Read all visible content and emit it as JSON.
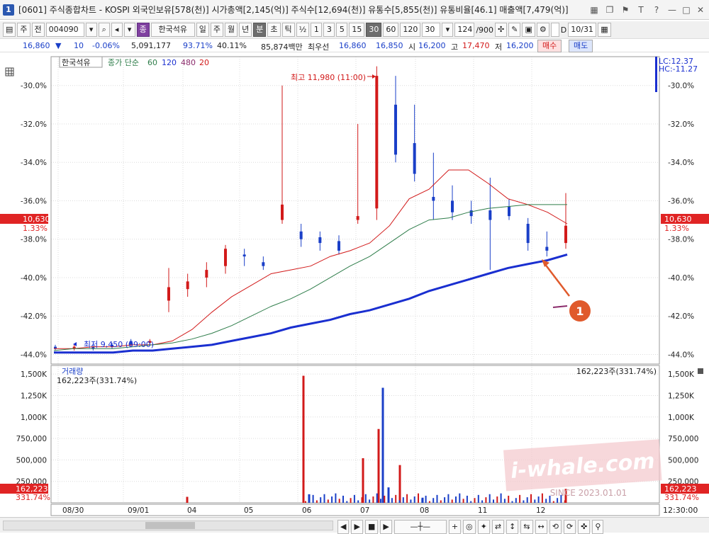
{
  "window": {
    "badge": "1",
    "title": "[0601] 주식종합차트 - KOSPI 외국인보유[578(천)] 시가총액[2,145(억)] 주식수[12,694(천)] 유통수[5,855(천)] 유통비율[46.1] 매출액[7,479(억)]",
    "icons": [
      "grid-icon",
      "copy-icon",
      "flag-icon",
      "text-icon",
      "help-icon",
      "minimize-icon",
      "maximize-icon",
      "close-icon"
    ]
  },
  "toolbar": {
    "market": "주",
    "all_label": "전",
    "code": "004090",
    "name_tag": "종",
    "stock_name": "한국석유",
    "periods": [
      "일",
      "주",
      "월",
      "년",
      "분",
      "초",
      "틱"
    ],
    "period_selected": "분",
    "half": "½",
    "intervals": [
      "1",
      "3",
      "5",
      "15",
      "30",
      "60",
      "120"
    ],
    "interval_selected": "30",
    "interval_value": "30",
    "count": "124",
    "count_total": "/900",
    "d_label": "D",
    "date": "10/31"
  },
  "quote": {
    "price": "16,860",
    "change": "10",
    "change_pct": "-0.06%",
    "volume": "5,091,177",
    "ratio1": "93.71%",
    "ratio2": "40.11%",
    "amount": "85,874백만",
    "best_label": "최우선",
    "best_ask": "16,860",
    "best_bid": "16,850",
    "open_label": "시",
    "open": "16,200",
    "high_label": "고",
    "high": "17,470",
    "low_label": "저",
    "low": "16,200",
    "buy_label": "매수",
    "sell_label": "매도"
  },
  "price_panel": {
    "legend_name": "한국석유",
    "legend_ma_label": "종가 단순",
    "ma_periods": [
      "60",
      "120",
      "480",
      "20"
    ],
    "lc_label": "LC:12.37",
    "hc_label": "HC:-11.27",
    "current_price_tag": "10,630",
    "current_pct_tag": "1.33%",
    "high_annotation": "최고 11,980 (11:00)",
    "low_annotation": "최저 9,450 (09:00)",
    "marker_number": "1"
  },
  "volume_panel": {
    "legend": "거래량",
    "last_value": "162,223주(331.74%)",
    "tag_value": "162,223",
    "tag_pct": "331.74%"
  },
  "watermark": {
    "text": "i-whale.com",
    "since": "SINCE 2023.01.01"
  },
  "xaxis": {
    "time_label": "12:30:00"
  },
  "colors": {
    "up": "#d21a1a",
    "down": "#1a3fc8",
    "ma20": "#d21a1a",
    "ma60": "#2e7d4a",
    "ma120": "#1a2fd0",
    "tag_red": "#e02424",
    "marker": "#e05a2c"
  },
  "chart_data": [
    {
      "type": "line",
      "title": "",
      "y_axis_unit": "%",
      "ylim": [
        -44.5,
        -28.5
      ],
      "yticks": [
        "-30.0%",
        "-32.0%",
        "-34.0%",
        "-36.0%",
        "-38.0%",
        "-40.0%",
        "-42.0%",
        "-44.0%"
      ],
      "ytick_values": [
        -30,
        -32,
        -34,
        -36,
        -38,
        -40,
        -42,
        -44
      ],
      "categories": [
        "08/30",
        "09/01",
        "04",
        "05",
        "06",
        "07",
        "08",
        "11",
        "12"
      ],
      "series": [
        {
          "name": "20",
          "values": [
            -43.7,
            -43.7,
            -43.6,
            -43.6,
            -43.5,
            -43.5,
            -43.3,
            -42.7,
            -41.8,
            -41.0,
            -40.4,
            -39.8,
            -39.6,
            -39.4,
            -38.9,
            -38.6,
            -38.2,
            -37.3,
            -35.9,
            -35.4,
            -34.4,
            -34.4,
            -35.1,
            -35.9,
            -36.2,
            -36.6,
            -37.2
          ]
        },
        {
          "name": "60",
          "values": [
            -43.8,
            -43.7,
            -43.7,
            -43.7,
            -43.6,
            -43.5,
            -43.4,
            -43.2,
            -42.9,
            -42.5,
            -42.0,
            -41.5,
            -41.1,
            -40.6,
            -40.0,
            -39.4,
            -38.9,
            -38.2,
            -37.5,
            -37.0,
            -36.9,
            -36.6,
            -36.4,
            -36.3,
            -36.2,
            -36.2,
            -36.2
          ]
        },
        {
          "name": "120",
          "values": [
            -43.9,
            -43.9,
            -43.9,
            -43.9,
            -43.8,
            -43.8,
            -43.7,
            -43.6,
            -43.5,
            -43.3,
            -43.1,
            -42.9,
            -42.6,
            -42.4,
            -42.2,
            -41.9,
            -41.7,
            -41.4,
            -41.1,
            -40.7,
            -40.4,
            -40.1,
            -39.8,
            -39.5,
            -39.3,
            -39.1,
            -38.8
          ]
        }
      ]
    },
    {
      "type": "bar",
      "title": "",
      "ylim": [
        0,
        1600000
      ],
      "yticks": [
        "1,500K",
        "1,250K",
        "1,000K",
        "750,000",
        "500,000",
        "250,000"
      ],
      "ytick_values": [
        1500000,
        1250000,
        1000000,
        750000,
        500000,
        250000
      ],
      "series": [
        {
          "name": "up",
          "values": [
            {
              "x": "04",
              "v": 70000
            },
            {
              "x": "06",
              "v": 1480000
            },
            {
              "x": "07a",
              "v": 520000
            },
            {
              "x": "07b",
              "v": 860000
            },
            {
              "x": "07c",
              "v": 440000
            },
            {
              "x": "12",
              "v": 162223
            }
          ]
        },
        {
          "name": "down",
          "values": [
            {
              "x": "06b",
              "v": 100000
            },
            {
              "x": "07d",
              "v": 1340000
            },
            {
              "x": "07e",
              "v": 180000
            },
            {
              "x": "08",
              "v": 60000
            }
          ]
        }
      ]
    }
  ]
}
